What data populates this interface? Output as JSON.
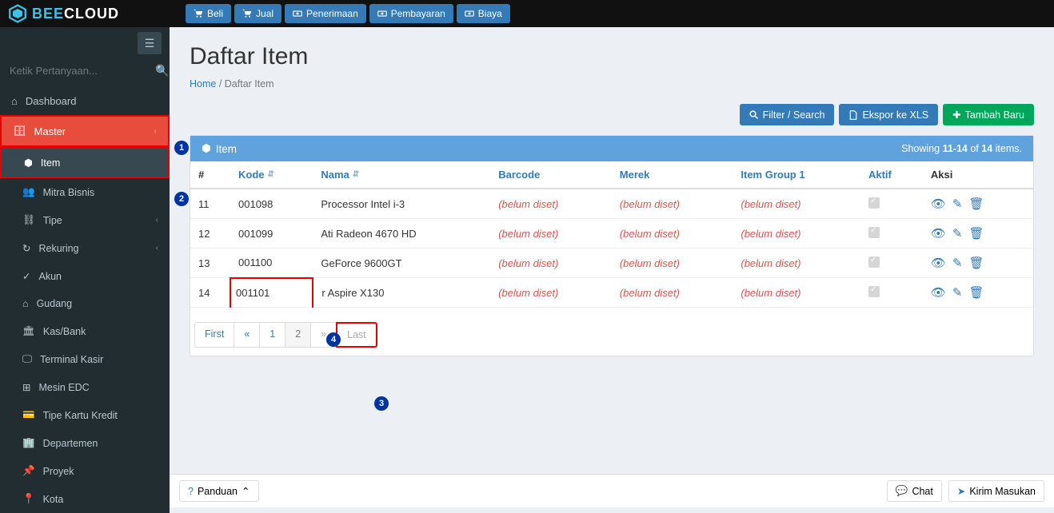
{
  "brand": {
    "part1": "BEE",
    "part2": "CLOUD"
  },
  "topButtons": [
    {
      "label": "Beli",
      "icon": "cart"
    },
    {
      "label": "Jual",
      "icon": "cart"
    },
    {
      "label": "Penerimaan",
      "icon": "money"
    },
    {
      "label": "Pembayaran",
      "icon": "money"
    },
    {
      "label": "Biaya",
      "icon": "money"
    }
  ],
  "search": {
    "placeholder": "Ketik Pertanyaan..."
  },
  "nav": {
    "dashboard": "Dashboard",
    "master": "Master",
    "sub": {
      "item": "Item",
      "mitra": "Mitra Bisnis",
      "tipe": "Tipe",
      "rekuring": "Rekuring",
      "akun": "Akun",
      "gudang": "Gudang",
      "kasbank": "Kas/Bank",
      "terminal": "Terminal Kasir",
      "mesin": "Mesin EDC",
      "tipekartu": "Tipe Kartu Kredit",
      "departemen": "Departemen",
      "proyek": "Proyek",
      "kota": "Kota"
    }
  },
  "page": {
    "title": "Daftar Item",
    "crumbHome": "Home",
    "crumbHere": "Daftar Item"
  },
  "actions": {
    "filter": "Filter / Search",
    "export": "Ekspor ke XLS",
    "add": "Tambah Baru"
  },
  "panel": {
    "title": "Item",
    "showingPrefix": "Showing",
    "range": "11-14",
    "of": "of",
    "total": "14",
    "itemsSuffix": "items."
  },
  "columns": {
    "idx": "#",
    "kode": "Kode",
    "nama": "Nama",
    "barcode": "Barcode",
    "merek": "Merek",
    "group": "Item Group 1",
    "aktif": "Aktif",
    "aksi": "Aksi"
  },
  "notset": "(belum diset)",
  "rows": [
    {
      "n": "11",
      "kode": "001098",
      "nama": "Processor Intel i-3"
    },
    {
      "n": "12",
      "kode": "001099",
      "nama": "Ati Radeon 4670 HD"
    },
    {
      "n": "13",
      "kode": "001100",
      "nama": "GeForce 9600GT"
    },
    {
      "n": "14",
      "kode": "001101",
      "nama": "r Aspire X130"
    }
  ],
  "pager": {
    "first": "First",
    "prev": "«",
    "p1": "1",
    "p2": "2",
    "next": "»",
    "last": "Last"
  },
  "footer": {
    "panduan": "Panduan",
    "chat": "Chat",
    "feedback": "Kirim Masukan"
  }
}
